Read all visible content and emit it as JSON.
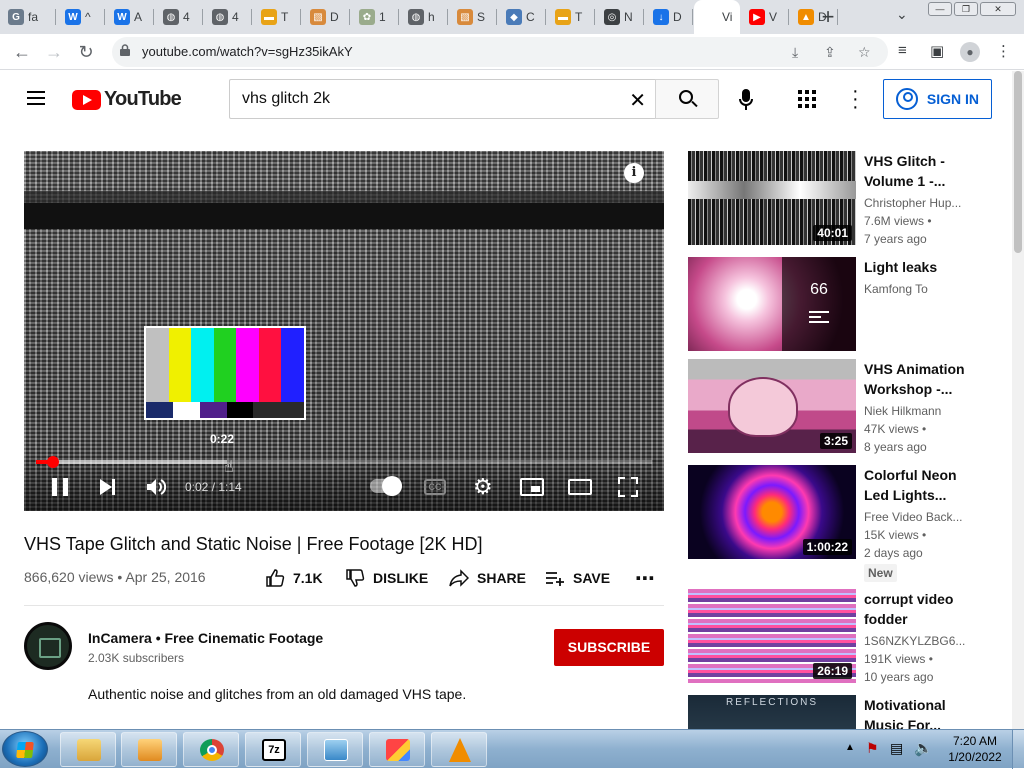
{
  "tabs": [
    {
      "label": "fa",
      "fav_color": "#6b7b8c",
      "fav_text": "G"
    },
    {
      "label": "^",
      "fav_color": "#1a73e8",
      "fav_text": "W"
    },
    {
      "label": "A",
      "fav_color": "#1a73e8",
      "fav_text": "W"
    },
    {
      "label": "4",
      "fav_color": "#5f6368",
      "fav_text": "◍"
    },
    {
      "label": "4",
      "fav_color": "#5f6368",
      "fav_text": "◍"
    },
    {
      "label": "T",
      "fav_color": "#e8a317",
      "fav_text": "▬"
    },
    {
      "label": "D",
      "fav_color": "#d88a3c",
      "fav_text": "▧"
    },
    {
      "label": "1",
      "fav_color": "#9aab8c",
      "fav_text": "✿"
    },
    {
      "label": "h",
      "fav_color": "#5f6368",
      "fav_text": "◍"
    },
    {
      "label": "S",
      "fav_color": "#d88a3c",
      "fav_text": "▧"
    },
    {
      "label": "C",
      "fav_color": "#4a7bb8",
      "fav_text": "◆"
    },
    {
      "label": "T",
      "fav_color": "#e8a317",
      "fav_text": "▬"
    },
    {
      "label": "N",
      "fav_color": "#3c4043",
      "fav_text": "◎"
    },
    {
      "label": "D",
      "fav_color": "#1a73e8",
      "fav_text": "↓"
    },
    {
      "label": "Vi",
      "fav_color": "#ffffff",
      "fav_text": ""
    },
    {
      "label": "V",
      "fav_color": "#ff0000",
      "fav_text": "▶"
    },
    {
      "label": "D",
      "fav_color": "#f08c00",
      "fav_text": "▲"
    }
  ],
  "browser": {
    "url": "youtube.com/watch?v=sgHz35ikAkY"
  },
  "header": {
    "logo_text": "YouTube",
    "search_query": "vhs glitch 2k",
    "signin_label": "SIGN IN"
  },
  "player": {
    "preview_time": "0:22",
    "time_display": "0:02 / 1:14",
    "played_fraction": 0.027,
    "loaded_fraction": 0.31,
    "preview_colors": [
      "#c0c0c0",
      "#f0f000",
      "#00f0f0",
      "#20d020",
      "#ff00ff",
      "#ff1040",
      "#2020ff"
    ],
    "preview_lower_colors": [
      "#1a2a6a",
      "#ffffff",
      "#50208a",
      "#000000",
      "#2a2a2a"
    ]
  },
  "video": {
    "title": "VHS Tape Glitch and Static Noise | Free Footage [2K HD]",
    "meta": "866,620 views • Apr 25, 2016",
    "likes": "7.1K",
    "dislike_label": "DISLIKE",
    "share_label": "SHARE",
    "save_label": "SAVE"
  },
  "channel": {
    "name": "InCamera • Free Cinematic Footage",
    "subscribers": "2.03K subscribers",
    "subscribe_label": "SUBSCRIBE",
    "description": "Authentic noise and glitches from an old damaged VHS tape."
  },
  "recommendations": [
    {
      "title": "VHS Glitch - Volume 1 -...",
      "channel": "Christopher Hup...",
      "views": "7.6M views •",
      "age": "7 years ago",
      "duration": "40:01",
      "badge": ""
    },
    {
      "title": "Light leaks",
      "channel": "Kamfong To",
      "views": "",
      "age": "",
      "duration": "",
      "badge": "",
      "playlist_count": "66"
    },
    {
      "title": "VHS Animation Workshop -...",
      "channel": "Niek Hilkmann",
      "views": "47K views •",
      "age": "8 years ago",
      "duration": "3:25",
      "badge": ""
    },
    {
      "title": "Colorful Neon Led Lights...",
      "channel": "Free Video Back...",
      "views": "15K views •",
      "age": "2 days ago",
      "duration": "1:00:22",
      "badge": "New"
    },
    {
      "title": "corrupt video fodder",
      "channel": "1S6NZKYLZBG6...",
      "views": "191K views •",
      "age": "10 years ago",
      "duration": "26:19",
      "badge": ""
    },
    {
      "title": "Motivational Music For...",
      "channel": "",
      "views": "",
      "age": "",
      "duration": "",
      "badge": "",
      "thumb_text": "REFLECTIONS"
    }
  ],
  "taskbar": {
    "time": "7:20 AM",
    "date": "1/20/2022"
  }
}
